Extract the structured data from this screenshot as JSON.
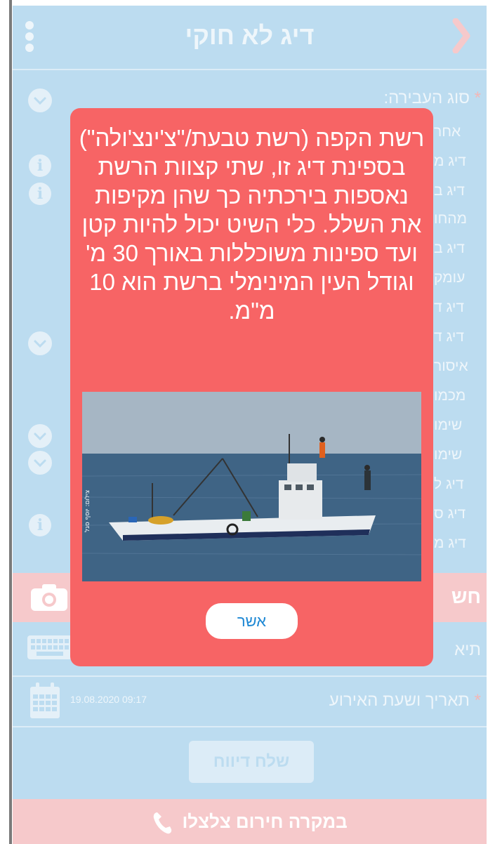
{
  "header": {
    "title": "דיג לא חוקי"
  },
  "form": {
    "vessel_label": "סוג העבירה:",
    "required_mark": "*",
    "options": [
      "אחר",
      "דיג מ",
      "דיג ב",
      "מהחו",
      "דיג ב",
      "עומק",
      "דיג ד",
      "דיג ד",
      "איסור",
      "מכמו",
      "שימו",
      "שימו",
      "דיג ל",
      "דיג ס",
      "דיג מ"
    ],
    "photo_label": "חש",
    "notes_label": "תיא",
    "date_label": "תאריך ושעת האירוע",
    "date_value": "19.08.2020 09:17",
    "send_button": "שלח דיווח",
    "emergency": "במקרה חירום צלצלו"
  },
  "modal": {
    "text": "רשת הקפה (רשת טבעת/\"צ'ינצ'ולה\") בספינת דיג זו, שתי קצוות הרשת נאספות בירכתיה כך שהן מקיפות את השלל. כלי השיט יכול להיות קטן ועד ספינות משוכללות באורך 30 מ' וגודל העין המינימלי ברשת הוא 10 מ\"מ.",
    "image_caption": "צילום: יוסף סגל",
    "ok_button": "אשר"
  },
  "colors": {
    "background": "#bcdcf0",
    "modal": "#f76465",
    "accent_button_text": "#1e88d4",
    "emergency": "#f6c9cb"
  },
  "icons": [
    "menu-dots-icon",
    "back-chevron-icon",
    "chevron-down-icon",
    "info-icon",
    "camera-icon",
    "keyboard-icon",
    "calendar-icon",
    "phone-icon"
  ]
}
